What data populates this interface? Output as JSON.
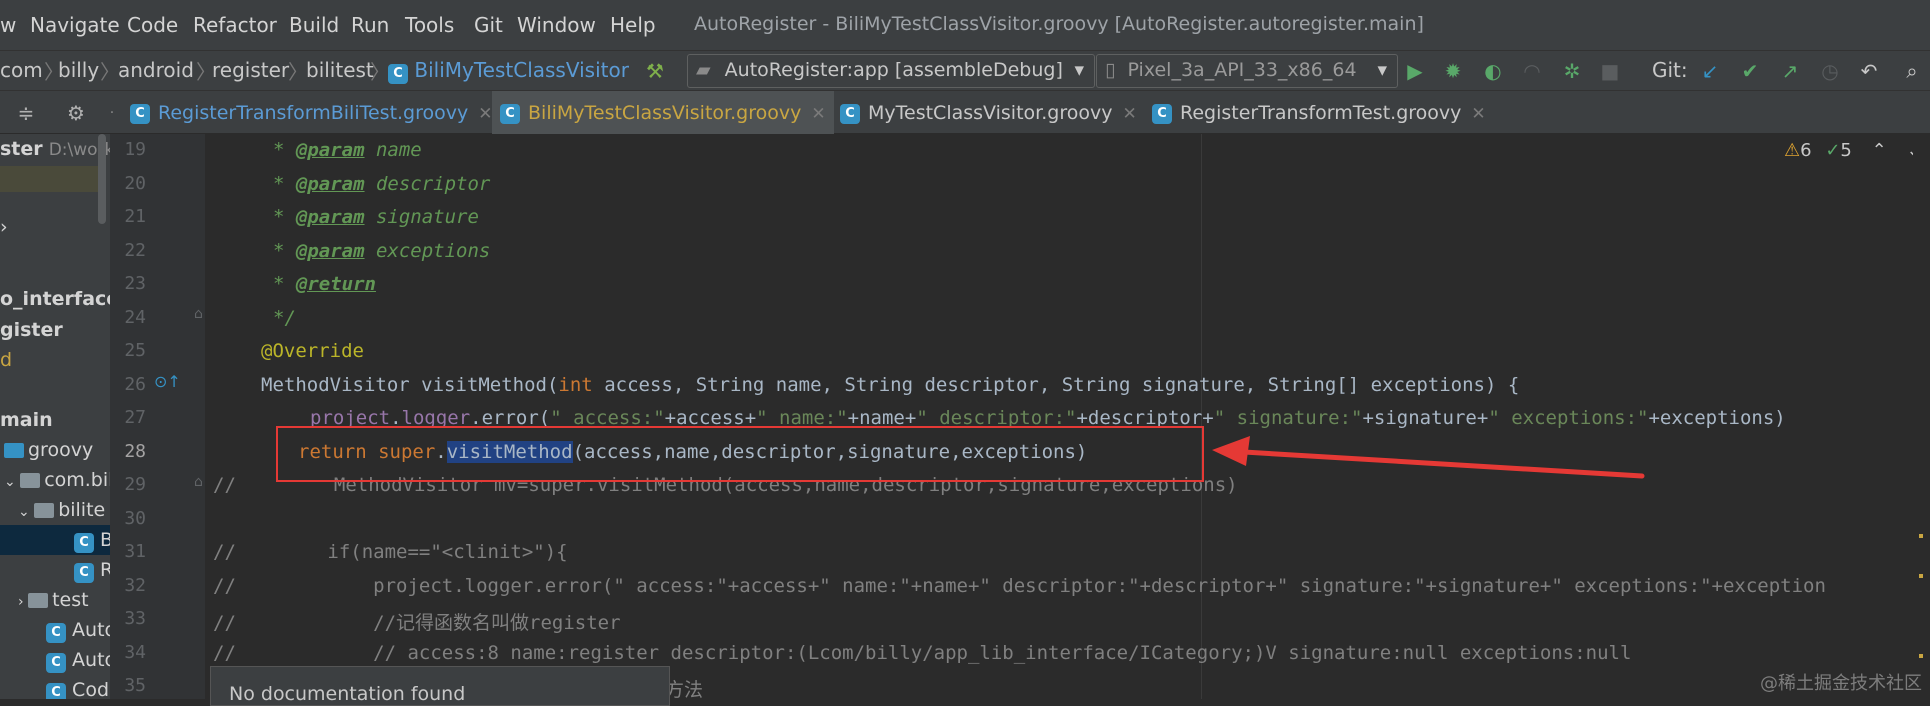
{
  "menu": {
    "items": [
      "w",
      "Navigate",
      "Code",
      "Refactor",
      "Build",
      "Run",
      "Tools",
      "Git",
      "Window",
      "Help"
    ],
    "window_title": "AutoRegister - BiliMyTestClassVisitor.groovy [AutoRegister.autoregister.main]"
  },
  "breadcrumb": [
    "com",
    "billy",
    "android",
    "register",
    "bilitest",
    "BiliMyTestClassVisitor"
  ],
  "toolbar": {
    "run_config": "AutoRegister:app [assembleDebug]",
    "device": "Pixel_3a_API_33_x86_64",
    "git_label": "Git:"
  },
  "tabs": [
    {
      "label": "RegisterTransformBiliTest.groovy",
      "active": false
    },
    {
      "label": "BiliMyTestClassVisitor.groovy",
      "active": true
    },
    {
      "label": "MyTestClassVisitor.groovy",
      "active": false
    },
    {
      "label": "RegisterTransformTest.groovy",
      "active": false
    }
  ],
  "project_tree": {
    "root_label": "ster",
    "root_path": "D:\\works",
    "items": [
      "o_interface",
      "gister",
      "d",
      "main",
      "groovy",
      "com.bil",
      "bilite",
      "B",
      "R",
      "test",
      "Auto",
      "Auto",
      "Code"
    ]
  },
  "line_numbers": [
    "19",
    "20",
    "21",
    "22",
    "23",
    "24",
    "25",
    "26",
    "27",
    "28",
    "29",
    "30",
    "31",
    "32",
    "33",
    "34",
    "35"
  ],
  "code": {
    "l19": "@param",
    "l19b": " name",
    "l20": "@param",
    "l20b": " descriptor",
    "l21": "@param",
    "l21b": " signature",
    "l22": "@param",
    "l22b": " exceptions",
    "l23": "@return",
    "l24": "*/",
    "l25": "@Override",
    "l26a": "MethodVisitor visitMethod(",
    "l26b": "int",
    "l26c": " access, String name, String descriptor, String signature, String[] exceptions) {",
    "l27a": "project",
    "l27b": ".",
    "l27c": "logger",
    "l27d": ".error(",
    "l27e": "\" access:\"",
    "l27f": "+access+",
    "l27g": "\" name:\"",
    "l27h": "+name+",
    "l27i": "\" descriptor:\"",
    "l27j": "+descriptor+",
    "l27k": "\" signature:\"",
    "l27l": "+signature+",
    "l27m": "\" exceptions:\"",
    "l27n": "+exceptions)",
    "l28a": "return",
    "l28b": " super",
    "l28c": ".",
    "l28d": "visitMethod",
    "l28e": "(access,name,descriptor,signature,exceptions)",
    "l29a": "//",
    "l29b": "MethodVisitor mv=super.visitMethod(access,name,descriptor,signature,exceptions)",
    "l31": "//        if(name==\"<clinit>\"){",
    "l32": "//            project.logger.error(\" access:\"+access+\" name:\"+name+\" descriptor:\"+descriptor+\" signature:\"+signature+\" exceptions:\"+exception",
    "l33": "//            //记得函数名叫做register",
    "l34": "//            // access:8 name:register descriptor:(Lcom/billy/app_lib_interface/ICategory;)V signature:null exceptions:null",
    "l35": "方法"
  },
  "inspections": {
    "warnings": "6",
    "ok": "5"
  },
  "doc_popup": "No documentation found",
  "watermark": "@稀土掘金技术社区",
  "colors": {
    "callout": "#e53935",
    "selection": "#214283",
    "accent": "#4a88c7"
  }
}
